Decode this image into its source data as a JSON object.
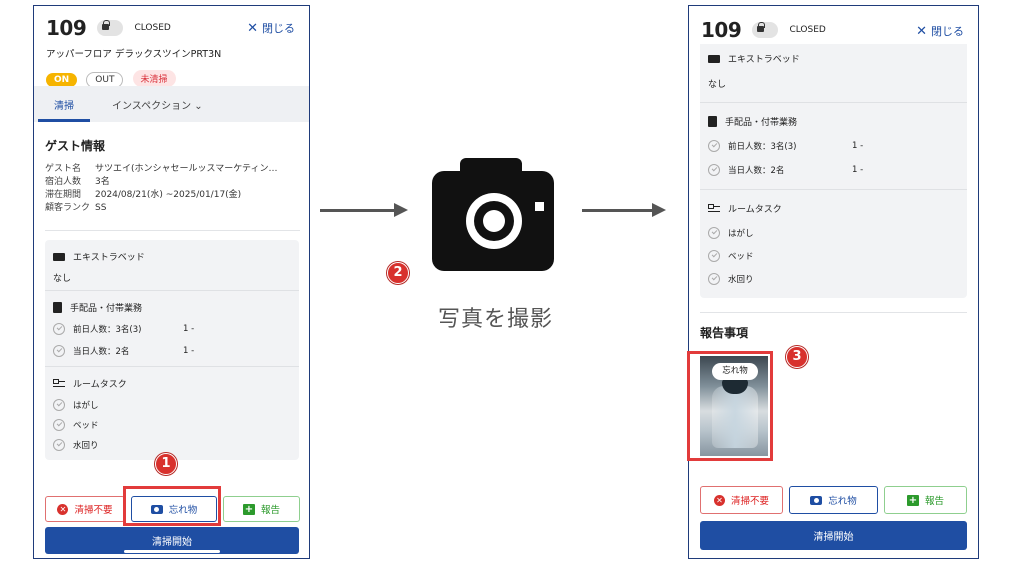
{
  "left": {
    "room_number": "109",
    "status": "CLOSED",
    "close_label": "閉じる",
    "room_type": "アッパーフロア デラックスツインPRT3N",
    "badges": [
      "ON",
      "OUT",
      "未清掃"
    ],
    "tabs": [
      "清掃",
      "インスペクション"
    ],
    "guest_section_title": "ゲスト情報",
    "guest": [
      {
        "k": "ゲスト名",
        "v": "サツエイ(ホンシャセールッスマーケティン…"
      },
      {
        "k": "宿泊人数",
        "v": "3名"
      },
      {
        "k": "滞在期間",
        "v": "2024/08/21(水) ~2025/01/17(金)"
      },
      {
        "k": "顧客ランク",
        "v": "SS"
      }
    ],
    "extra_bed_label": "エキストラベッド",
    "extra_bed_value": "なし",
    "amenities_label": "手配品・付帯業務",
    "amenity_items": [
      {
        "label": "前日人数：3名(3)",
        "qty": "1 -"
      },
      {
        "label": "当日人数：2名",
        "qty": "1 -"
      }
    ],
    "tasks_label": "ルームタスク",
    "tasks": [
      "はがし",
      "ベッド",
      "水回り"
    ],
    "btn_unneeded": "清掃不要",
    "btn_lost": "忘れ物",
    "btn_report": "報告",
    "btn_start": "清掃開始"
  },
  "right": {
    "room_number": "109",
    "status": "CLOSED",
    "close_label": "閉じる",
    "extra_bed_label": "エキストラベッド",
    "extra_bed_value": "なし",
    "amenities_label": "手配品・付帯業務",
    "amenity_items": [
      {
        "label": "前日人数：3名(3)",
        "qty": "1 -"
      },
      {
        "label": "当日人数：2名",
        "qty": "1 -"
      }
    ],
    "tasks_label": "ルームタスク",
    "tasks": [
      "はがし",
      "ベッド",
      "水回り"
    ],
    "report_title": "報告事項",
    "photo_tag": "忘れ物",
    "btn_unneeded": "清掃不要",
    "btn_lost": "忘れ物",
    "btn_report": "報告",
    "btn_start": "清掃開始"
  },
  "middle": {
    "caption": "写真を撮影"
  },
  "steps": [
    "1",
    "2",
    "3"
  ],
  "colors": {
    "primary": "#1f4ea3",
    "accent_red": "#d8312d",
    "on_badge": "#f6b400",
    "report_green": "#2c9a2c"
  }
}
